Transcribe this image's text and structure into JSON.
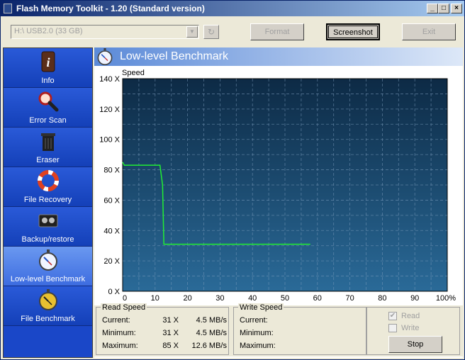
{
  "window": {
    "title": "Flash Memory Toolkit - 1.20 (Standard version)",
    "controls": {
      "minimize": "_",
      "maximize": "□",
      "close": "×"
    }
  },
  "toolbar": {
    "drive": "H:\\ USB2.0 (33 GB)",
    "refresh_icon": "↻",
    "format_label": "Format",
    "screenshot_label": "Screenshot",
    "exit_label": "Exit"
  },
  "sidebar": {
    "items": [
      {
        "label": "Info",
        "icon": "info-icon"
      },
      {
        "label": "Error Scan",
        "icon": "magnifier-icon"
      },
      {
        "label": "Eraser",
        "icon": "trash-icon"
      },
      {
        "label": "File Recovery",
        "icon": "lifebuoy-icon"
      },
      {
        "label": "Backup/restore",
        "icon": "tape-icon"
      },
      {
        "label": "Low-level Benchmark",
        "icon": "stopwatch-icon",
        "active": true
      },
      {
        "label": "File Benchmark",
        "icon": "stopwatch-gold-icon"
      }
    ]
  },
  "content": {
    "title": "Low-level Benchmark",
    "speed_label": "Speed"
  },
  "chart_data": {
    "type": "line",
    "ylabel": "Speed",
    "xlim": [
      0,
      100
    ],
    "ylim": [
      0,
      140
    ],
    "x_ticks": [
      "0",
      "10",
      "20",
      "30",
      "40",
      "50",
      "60",
      "70",
      "80",
      "90",
      "100%"
    ],
    "y_ticks": [
      "0 X",
      "20 X",
      "40 X",
      "60 X",
      "80 X",
      "100 X",
      "120 X",
      "140 X"
    ],
    "grid": true,
    "background_color": "#1e4f79",
    "series": [
      {
        "color": "#22ee33",
        "x": [
          0,
          0.5,
          11.5,
          12.3,
          12.7,
          57.8
        ],
        "y": [
          85,
          83,
          83,
          70,
          31,
          31
        ]
      }
    ]
  },
  "read_speed": {
    "title": "Read Speed",
    "rows": [
      {
        "label": "Current:",
        "x": "31 X",
        "mbps": "4.5 MB/s"
      },
      {
        "label": "Minimum:",
        "x": "31 X",
        "mbps": "4.5 MB/s"
      },
      {
        "label": "Maximum:",
        "x": "85 X",
        "mbps": "12.6 MB/s"
      }
    ]
  },
  "write_speed": {
    "title": "Write Speed",
    "rows": [
      {
        "label": "Current:"
      },
      {
        "label": "Minimum:"
      },
      {
        "label": "Maximum:"
      }
    ]
  },
  "options": {
    "read_label": "Read",
    "read_checked": true,
    "write_label": "Write",
    "write_checked": false,
    "stop_label": "Stop"
  }
}
